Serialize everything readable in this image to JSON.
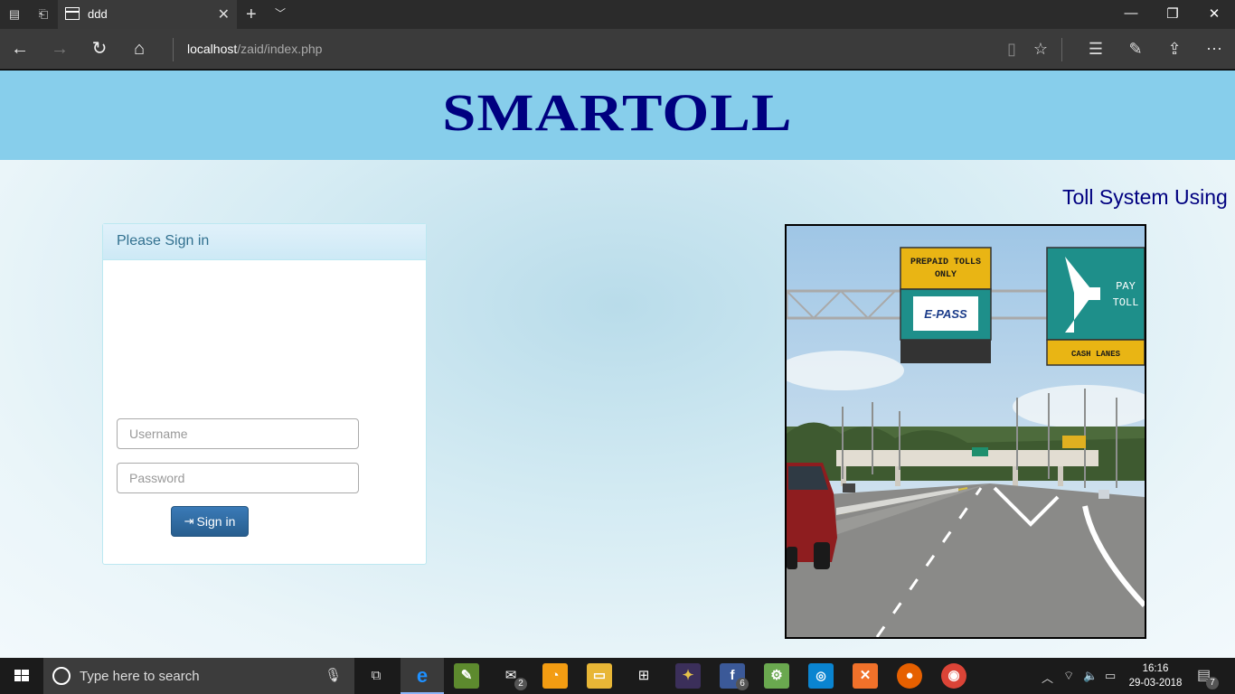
{
  "browser": {
    "tab_title": "ddd",
    "address_host": "localhost",
    "address_path": "/zaid/index.php"
  },
  "page": {
    "logo": "SMARTOLL",
    "marquee": "Toll System Using",
    "panel_title": "Please Sign in",
    "username_placeholder": "Username",
    "password_placeholder": "Password",
    "signin_label": "Sign in"
  },
  "photo_signs": {
    "prepaid_line1": "PREPAID TOLLS",
    "prepaid_line2": "ONLY",
    "epass": "E-PASS",
    "pay_line1": "PAY",
    "pay_line2": "TOLL",
    "cash_lanes": "CASH LANES"
  },
  "taskbar": {
    "search_placeholder": "Type here to search",
    "mail_badge": "2",
    "facebook_badge": "6",
    "notification_badge": "7",
    "time": "16:16",
    "date": "29-03-2018"
  },
  "colors": {
    "header_bg": "#87ceeb",
    "logo": "#000080",
    "panel_heading": "#31708f",
    "button": "#286090"
  }
}
